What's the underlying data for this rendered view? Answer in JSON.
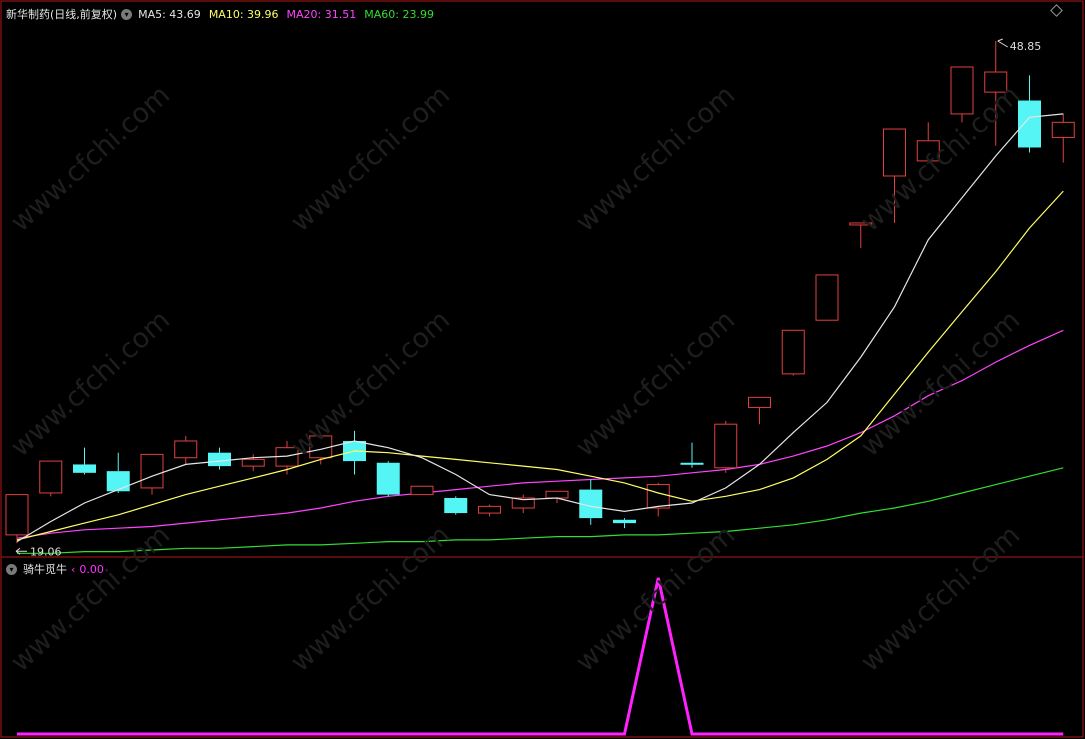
{
  "header": {
    "title": "新华制药(日线,前复权)",
    "ma": [
      {
        "label": "MA5: 43.69",
        "color": "#e6e6e6"
      },
      {
        "label": "MA10: 39.96",
        "color": "#ffff66"
      },
      {
        "label": "MA20: 31.51",
        "color": "#ff44ff"
      },
      {
        "label": "MA60: 23.99",
        "color": "#33dd33"
      }
    ]
  },
  "indicator": {
    "title": "骑牛觅牛",
    "value": "0.00",
    "value_color": "#ff33ff"
  },
  "watermark": "www.cfchi.com",
  "colors": {
    "up": "#e04040",
    "down": "#55f5f5",
    "ma5": "#e6e6e6",
    "ma10": "#ffff66",
    "ma20": "#ff44ff",
    "ma60": "#33dd33",
    "border": "#b01818",
    "signal": "#ff22ff"
  },
  "chart_data": [
    {
      "type": "candlestick",
      "price_range": [
        18.2,
        50.4
      ],
      "annotations": {
        "high": "48.85",
        "low": "19.06"
      },
      "candles": [
        {
          "o": 19.4,
          "h": 21.8,
          "l": 18.9,
          "c": 21.8
        },
        {
          "o": 21.9,
          "h": 23.8,
          "l": 21.7,
          "c": 23.8
        },
        {
          "o": 23.6,
          "h": 24.6,
          "l": 23.0,
          "c": 23.1
        },
        {
          "o": 23.2,
          "h": 24.3,
          "l": 21.9,
          "c": 22.0
        },
        {
          "o": 22.2,
          "h": 24.2,
          "l": 21.8,
          "c": 24.2
        },
        {
          "o": 24.0,
          "h": 25.3,
          "l": 23.6,
          "c": 25.0
        },
        {
          "o": 24.3,
          "h": 24.6,
          "l": 23.3,
          "c": 23.5
        },
        {
          "o": 23.5,
          "h": 24.2,
          "l": 23.2,
          "c": 23.9
        },
        {
          "o": 23.5,
          "h": 25.0,
          "l": 23.0,
          "c": 24.6
        },
        {
          "o": 24.0,
          "h": 25.2,
          "l": 23.6,
          "c": 25.3
        },
        {
          "o": 25.0,
          "h": 25.6,
          "l": 23.0,
          "c": 23.8
        },
        {
          "o": 23.7,
          "h": 23.8,
          "l": 21.7,
          "c": 21.8
        },
        {
          "o": 21.8,
          "h": 22.3,
          "l": 21.8,
          "c": 22.3
        },
        {
          "o": 21.6,
          "h": 21.7,
          "l": 20.6,
          "c": 20.7
        },
        {
          "o": 20.7,
          "h": 21.2,
          "l": 20.5,
          "c": 21.1
        },
        {
          "o": 21.0,
          "h": 21.8,
          "l": 20.7,
          "c": 21.6
        },
        {
          "o": 21.6,
          "h": 22.0,
          "l": 21.3,
          "c": 22.0
        },
        {
          "o": 22.1,
          "h": 22.7,
          "l": 20.0,
          "c": 20.4
        },
        {
          "o": 20.3,
          "h": 20.4,
          "l": 19.8,
          "c": 20.1
        },
        {
          "o": 21.0,
          "h": 22.5,
          "l": 20.5,
          "c": 22.4
        },
        {
          "o": 23.7,
          "h": 24.9,
          "l": 23.4,
          "c": 23.6
        },
        {
          "o": 23.4,
          "h": 26.2,
          "l": 23.1,
          "c": 26.0
        },
        {
          "o": 27.0,
          "h": 27.6,
          "l": 26.0,
          "c": 27.6
        },
        {
          "o": 29.0,
          "h": 31.6,
          "l": 28.9,
          "c": 31.6
        },
        {
          "o": 32.2,
          "h": 34.9,
          "l": 32.2,
          "c": 34.9
        },
        {
          "o": 38.0,
          "h": 38.0,
          "l": 36.5,
          "c": 38.0
        },
        {
          "o": 40.8,
          "h": 43.6,
          "l": 38.0,
          "c": 43.6
        },
        {
          "o": 41.7,
          "h": 44.0,
          "l": 41.7,
          "c": 42.9
        },
        {
          "o": 44.5,
          "h": 47.3,
          "l": 44.0,
          "c": 47.3
        },
        {
          "o": 45.8,
          "h": 48.85,
          "l": 42.6,
          "c": 47.0
        },
        {
          "o": 45.3,
          "h": 46.8,
          "l": 42.2,
          "c": 42.5
        },
        {
          "o": 43.1,
          "h": 44.5,
          "l": 41.6,
          "c": 44.0
        }
      ],
      "ma_lines": {
        "MA5": [
          19.0,
          20.2,
          21.3,
          22.1,
          22.9,
          23.6,
          23.8,
          24.0,
          24.1,
          24.5,
          25.0,
          24.6,
          24.0,
          23.0,
          21.8,
          21.5,
          21.6,
          21.1,
          20.8,
          21.1,
          21.3,
          22.2,
          23.6,
          25.5,
          27.3,
          30.0,
          33.0,
          37.0,
          39.5,
          42.0,
          44.3,
          44.5
        ],
        "MA10": [
          19.1,
          19.6,
          20.1,
          20.6,
          21.2,
          21.8,
          22.3,
          22.8,
          23.3,
          23.9,
          24.4,
          24.3,
          24.1,
          23.9,
          23.7,
          23.5,
          23.3,
          22.9,
          22.5,
          21.9,
          21.4,
          21.7,
          22.1,
          22.8,
          23.9,
          25.3,
          27.8,
          30.3,
          32.7,
          35.1,
          37.7,
          39.9
        ],
        "MA20": [
          19.2,
          19.5,
          19.7,
          19.8,
          19.9,
          20.1,
          20.3,
          20.5,
          20.7,
          21.0,
          21.4,
          21.7,
          21.9,
          22.1,
          22.3,
          22.5,
          22.6,
          22.7,
          22.8,
          22.9,
          23.1,
          23.3,
          23.6,
          24.1,
          24.7,
          25.5,
          26.5,
          27.7,
          28.6,
          29.7,
          30.7,
          31.6
        ],
        "MA60": [
          18.3,
          18.3,
          18.4,
          18.4,
          18.5,
          18.6,
          18.6,
          18.7,
          18.8,
          18.8,
          18.9,
          19.0,
          19.0,
          19.1,
          19.1,
          19.2,
          19.3,
          19.3,
          19.4,
          19.4,
          19.5,
          19.6,
          19.8,
          20.0,
          20.3,
          20.7,
          21.0,
          21.4,
          21.9,
          22.4,
          22.9,
          23.4
        ]
      }
    },
    {
      "type": "line",
      "title": "骑牛觅牛",
      "values": [
        0,
        0,
        0,
        0,
        0,
        0,
        0,
        0,
        0,
        0,
        0,
        0,
        0,
        0,
        0,
        0,
        0,
        0,
        0,
        1,
        0,
        0,
        0,
        0,
        0,
        0,
        0,
        0,
        0,
        0,
        0,
        0
      ]
    }
  ]
}
